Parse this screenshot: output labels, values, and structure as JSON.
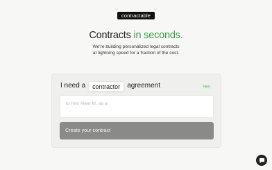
{
  "brand": {
    "logo_text": "contractable"
  },
  "hero": {
    "headline_main": "Contracts",
    "headline_accent": "in seconds.",
    "sub_line_1": "We're building personalized legal contracts",
    "sub_line_2": "at lightning speed for a fraction of the cost."
  },
  "form": {
    "lead_text": "I need a",
    "contract_type": "contractor",
    "trail_text": "agreement",
    "badge": "beta",
    "prompt_placeholder": "to hire Allen M. as a",
    "submit_label": "Create your contract"
  },
  "colors": {
    "accent": "#3f9b4a",
    "background": "#f7f7f5",
    "card": "#efefed",
    "button": "#8a8a88"
  },
  "icons": {
    "chat": "chat-bubble-icon"
  }
}
